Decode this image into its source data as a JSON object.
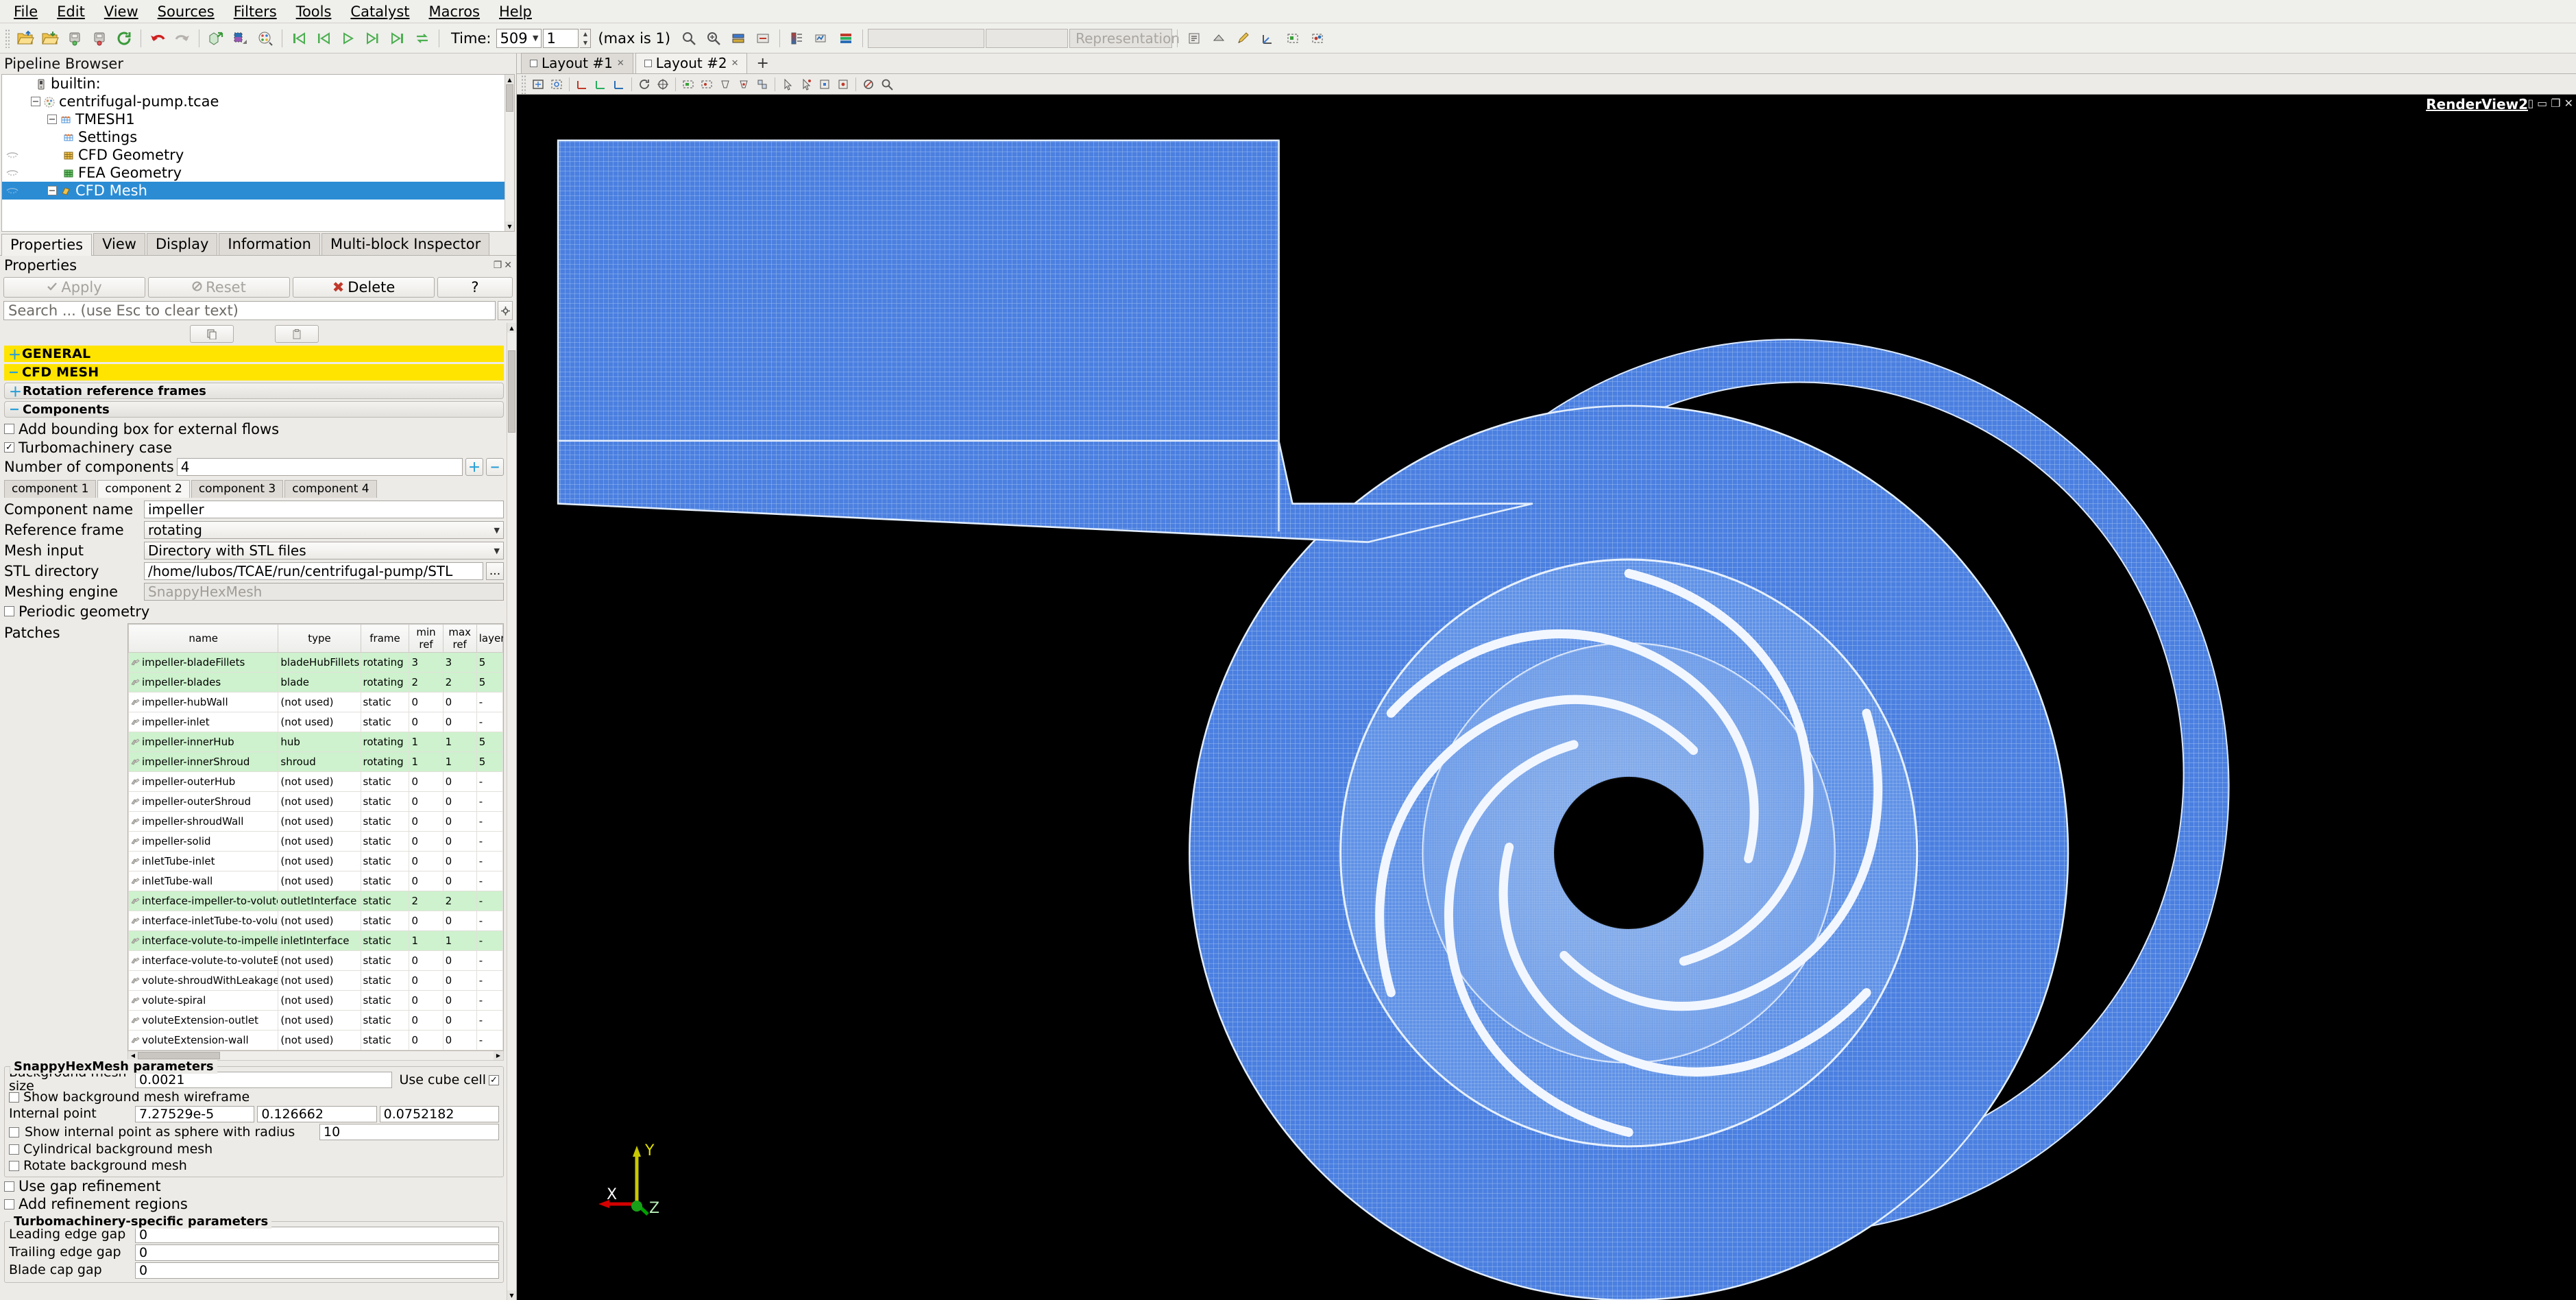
{
  "menubar": [
    "File",
    "Edit",
    "View",
    "Sources",
    "Filters",
    "Tools",
    "Catalyst",
    "Macros",
    "Help"
  ],
  "toolbar": {
    "time_label": "Time:",
    "time_value": "509",
    "frame_index": "1",
    "max_label": "(max is 1)",
    "representation_placeholder": "Representation"
  },
  "pipeline": {
    "title": "Pipeline Browser",
    "items": [
      {
        "label": "builtin:",
        "depth": 0,
        "icon": "server-icon",
        "expander": "",
        "selected": false,
        "eye": false
      },
      {
        "label": "centrifugal-pump.tcae",
        "depth": 1,
        "icon": "tcae-icon",
        "expander": "-",
        "selected": false,
        "eye": false
      },
      {
        "label": "TMESH1",
        "depth": 2,
        "icon": "mesh-icon",
        "expander": "-",
        "selected": false,
        "eye": false
      },
      {
        "label": "Settings",
        "depth": 3,
        "icon": "settings-icon",
        "expander": "",
        "selected": false,
        "eye": false
      },
      {
        "label": "CFD Geometry",
        "depth": 3,
        "icon": "cfd-geometry-icon",
        "expander": "",
        "selected": false,
        "eye": true
      },
      {
        "label": "FEA Geometry",
        "depth": 3,
        "icon": "fea-geometry-icon",
        "expander": "",
        "selected": false,
        "eye": true
      },
      {
        "label": "CFD Mesh",
        "depth": 3,
        "icon": "cfd-mesh-icon",
        "expander": "-",
        "selected": true,
        "eye": true
      }
    ]
  },
  "property_tabs": [
    {
      "label": "Properties",
      "active": true
    },
    {
      "label": "View",
      "active": false
    },
    {
      "label": "Display",
      "active": false
    },
    {
      "label": "Information",
      "active": false
    },
    {
      "label": "Multi-block Inspector",
      "active": false
    }
  ],
  "properties": {
    "header": "Properties",
    "apply_label": "Apply",
    "reset_label": "Reset",
    "delete_label": "Delete",
    "help_label": "?",
    "search_placeholder": "Search ... (use Esc to clear text)",
    "sections": {
      "general": "GENERAL",
      "cfd_mesh": "CFD MESH",
      "rotation_reference_frames": "Rotation reference frames",
      "components": "Components"
    },
    "add_bounding_box_label": "Add bounding box for external flows",
    "add_bounding_box_checked": false,
    "turbomachinery_label": "Turbomachinery case",
    "turbomachinery_checked": true,
    "number_of_components_label": "Number of components",
    "number_of_components_value": "4",
    "component_tabs": [
      {
        "label": "component 1",
        "active": false
      },
      {
        "label": "component 2",
        "active": true
      },
      {
        "label": "component 3",
        "active": false
      },
      {
        "label": "component 4",
        "active": false
      }
    ],
    "fields": {
      "component_name_label": "Component name",
      "component_name_value": "impeller",
      "reference_frame_label": "Reference frame",
      "reference_frame_value": "rotating",
      "mesh_input_label": "Mesh input",
      "mesh_input_value": "Directory with STL files",
      "stl_directory_label": "STL directory",
      "stl_directory_value": "/home/lubos/TCAE/run/centrifugal-pump/STL",
      "stl_browse_label": "...",
      "meshing_engine_label": "Meshing engine",
      "meshing_engine_value": "SnappyHexMesh",
      "periodic_geometry_label": "Periodic geometry",
      "periodic_geometry_checked": false
    },
    "patches_label": "Patches",
    "patches_table": {
      "columns": [
        "name",
        "type",
        "frame",
        "min ref",
        "max ref",
        "layers"
      ],
      "rows": [
        {
          "name": "impeller-bladeFillets",
          "type": "bladeHubFillets",
          "frame": "rotating",
          "min_ref": "3",
          "max_ref": "3",
          "layers": "5",
          "highlight": true
        },
        {
          "name": "impeller-blades",
          "type": "blade",
          "frame": "rotating",
          "min_ref": "2",
          "max_ref": "2",
          "layers": "5",
          "highlight": true
        },
        {
          "name": "impeller-hubWall",
          "type": "(not used)",
          "frame": "static",
          "min_ref": "0",
          "max_ref": "0",
          "layers": "-",
          "highlight": false
        },
        {
          "name": "impeller-inlet",
          "type": "(not used)",
          "frame": "static",
          "min_ref": "0",
          "max_ref": "0",
          "layers": "-",
          "highlight": false
        },
        {
          "name": "impeller-innerHub",
          "type": "hub",
          "frame": "rotating",
          "min_ref": "1",
          "max_ref": "1",
          "layers": "5",
          "highlight": true
        },
        {
          "name": "impeller-innerShroud",
          "type": "shroud",
          "frame": "rotating",
          "min_ref": "1",
          "max_ref": "1",
          "layers": "5",
          "highlight": true
        },
        {
          "name": "impeller-outerHub",
          "type": "(not used)",
          "frame": "static",
          "min_ref": "0",
          "max_ref": "0",
          "layers": "-",
          "highlight": false
        },
        {
          "name": "impeller-outerShroud",
          "type": "(not used)",
          "frame": "static",
          "min_ref": "0",
          "max_ref": "0",
          "layers": "-",
          "highlight": false
        },
        {
          "name": "impeller-shroudWall",
          "type": "(not used)",
          "frame": "static",
          "min_ref": "0",
          "max_ref": "0",
          "layers": "-",
          "highlight": false
        },
        {
          "name": "impeller-solid",
          "type": "(not used)",
          "frame": "static",
          "min_ref": "0",
          "max_ref": "0",
          "layers": "-",
          "highlight": false
        },
        {
          "name": "inletTube-inlet",
          "type": "(not used)",
          "frame": "static",
          "min_ref": "0",
          "max_ref": "0",
          "layers": "-",
          "highlight": false
        },
        {
          "name": "inletTube-wall",
          "type": "(not used)",
          "frame": "static",
          "min_ref": "0",
          "max_ref": "0",
          "layers": "-",
          "highlight": false
        },
        {
          "name": "interface-impeller-to-volute",
          "type": "outletInterface",
          "frame": "static",
          "min_ref": "2",
          "max_ref": "2",
          "layers": "-",
          "highlight": true
        },
        {
          "name": "interface-inletTube-to-volute",
          "type": "(not used)",
          "frame": "static",
          "min_ref": "0",
          "max_ref": "0",
          "layers": "-",
          "highlight": false
        },
        {
          "name": "interface-volute-to-impeller",
          "type": "inletInterface",
          "frame": "static",
          "min_ref": "1",
          "max_ref": "1",
          "layers": "-",
          "highlight": true
        },
        {
          "name": "interface-volute-to-voluteExt",
          "type": "(not used)",
          "frame": "static",
          "min_ref": "0",
          "max_ref": "0",
          "layers": "-",
          "highlight": false
        },
        {
          "name": "volute-shroudWithLeakage",
          "type": "(not used)",
          "frame": "static",
          "min_ref": "0",
          "max_ref": "0",
          "layers": "-",
          "highlight": false
        },
        {
          "name": "volute-spiral",
          "type": "(not used)",
          "frame": "static",
          "min_ref": "0",
          "max_ref": "0",
          "layers": "-",
          "highlight": false
        },
        {
          "name": "voluteExtension-outlet",
          "type": "(not used)",
          "frame": "static",
          "min_ref": "0",
          "max_ref": "0",
          "layers": "-",
          "highlight": false
        },
        {
          "name": "voluteExtension-wall",
          "type": "(not used)",
          "frame": "static",
          "min_ref": "0",
          "max_ref": "0",
          "layers": "-",
          "highlight": false
        }
      ]
    },
    "snappy": {
      "title": "SnappyHexMesh parameters",
      "background_mesh_size_label": "Background mesh size",
      "background_mesh_size_value": "0.0021",
      "use_cube_cell_label": "Use cube cell",
      "use_cube_cell_checked": true,
      "show_background_wireframe_label": "Show background mesh wireframe",
      "show_background_wireframe_checked": false,
      "internal_point_label": "Internal point",
      "internal_point_x": "7.27529e-5",
      "internal_point_y": "0.126662",
      "internal_point_z": "0.0752182",
      "show_internal_point_label": "Show internal point as sphere with radius",
      "show_internal_point_checked": false,
      "sphere_radius_value": "10",
      "cylindrical_background_label": "Cylindrical background mesh",
      "cylindrical_background_checked": false,
      "rotate_background_label": "Rotate background mesh",
      "rotate_background_checked": false,
      "use_gap_refinement_label": "Use gap refinement",
      "use_gap_refinement_checked": false,
      "add_refinement_regions_label": "Add refinement regions",
      "add_refinement_regions_checked": false
    },
    "turbo_params": {
      "title": "Turbomachinery-specific parameters",
      "leading_edge_gap_label": "Leading edge gap",
      "leading_edge_gap_value": "0",
      "trailing_edge_gap_label": "Trailing edge gap",
      "trailing_edge_gap_value": "0",
      "blade_cap_gap_label": "Blade cap gap",
      "blade_cap_gap_value": "0"
    }
  },
  "layout": {
    "tabs": [
      {
        "label": "Layout #1",
        "active": false
      },
      {
        "label": "Layout #2",
        "active": true
      }
    ],
    "add_label": "+"
  },
  "render_view": {
    "name": "RenderView2",
    "axes": {
      "x": "X",
      "y": "Y",
      "z": "Z"
    }
  },
  "colors": {
    "panel_bg": "#edebe7",
    "section_yellow": "#ffe400",
    "selection_blue": "#2b8cd4",
    "mesh_blue": "#3b6fd4",
    "viewport_black": "#000000",
    "patch_green": "#cdf2cd",
    "axis_x": "#d40000",
    "axis_y": "#d4d400",
    "axis_z": "#00a000"
  }
}
